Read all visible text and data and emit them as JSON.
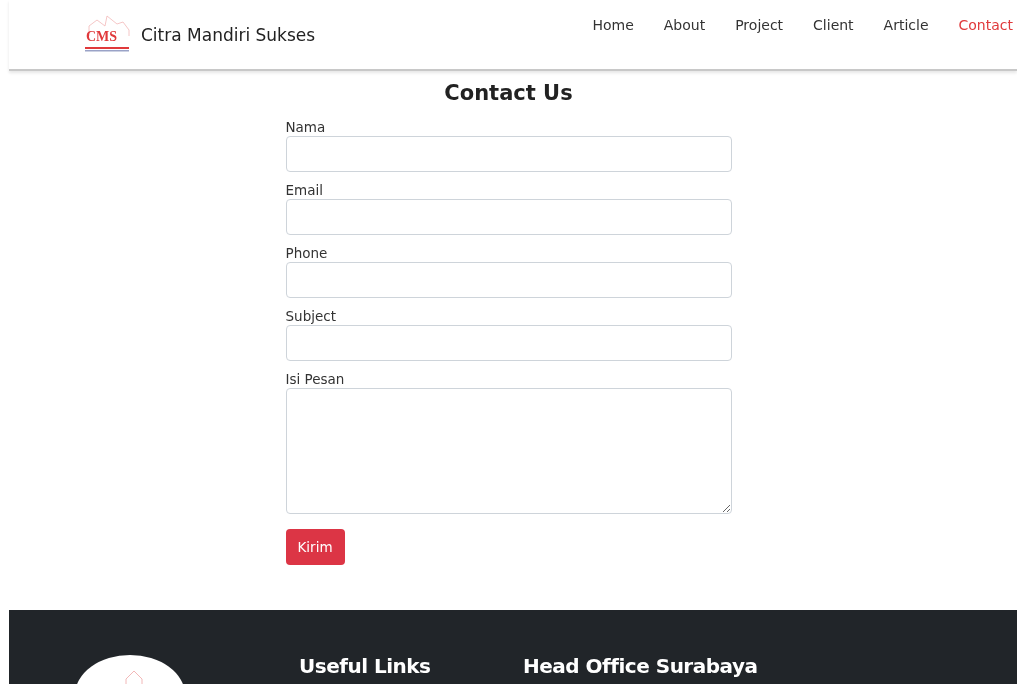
{
  "header": {
    "logo_text": "CMS",
    "brand": "Citra Mandiri Sukses",
    "nav": [
      {
        "label": "Home",
        "selected": false
      },
      {
        "label": "About",
        "selected": false
      },
      {
        "label": "Project",
        "selected": false
      },
      {
        "label": "Client",
        "selected": false
      },
      {
        "label": "Article",
        "selected": false
      },
      {
        "label": "Contact",
        "selected": true
      }
    ]
  },
  "form": {
    "title": "Contact Us",
    "fields": [
      {
        "label": "Nama",
        "kind": "input"
      },
      {
        "label": "Email",
        "kind": "input"
      },
      {
        "label": "Phone",
        "kind": "input"
      },
      {
        "label": "Subject",
        "kind": "input"
      },
      {
        "label": "Isi Pesan",
        "kind": "textarea"
      }
    ],
    "submit": "Kirim"
  },
  "footer": {
    "headings": [
      "Useful Links",
      "Head Office Surabaya"
    ]
  }
}
